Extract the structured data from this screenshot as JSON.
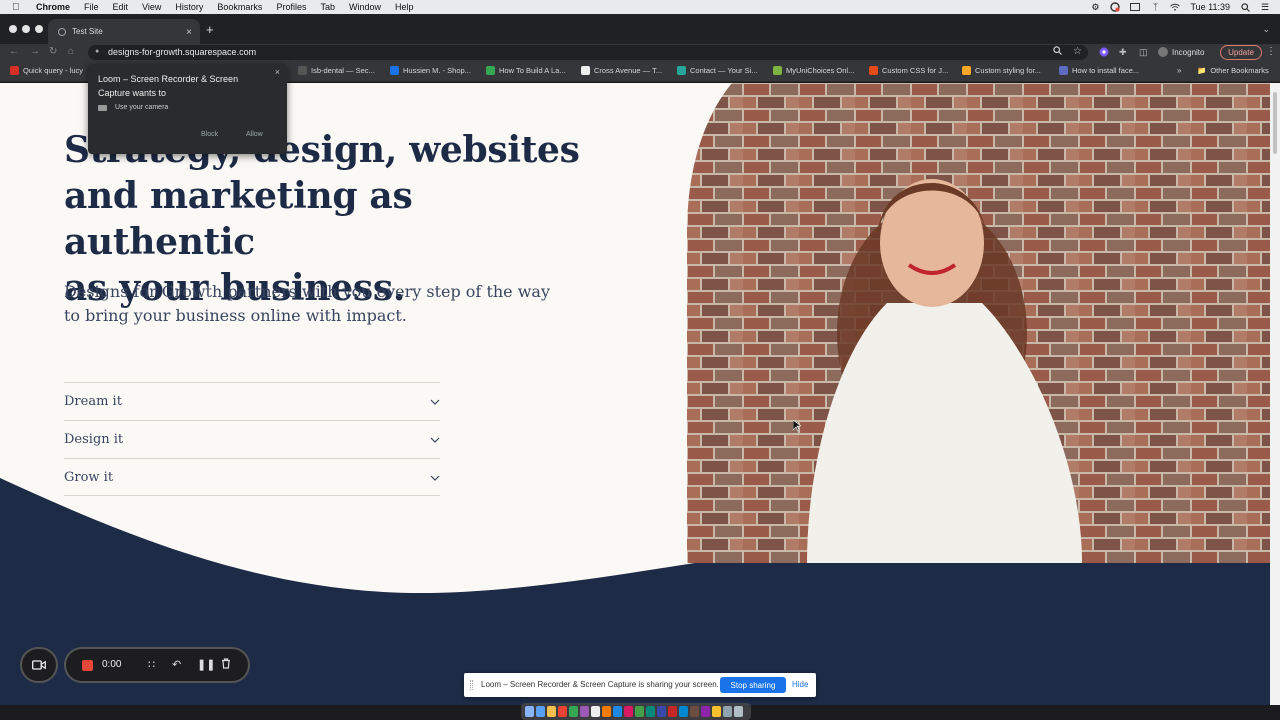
{
  "menubar": {
    "app": "Chrome",
    "items": [
      "File",
      "Edit",
      "View",
      "History",
      "Bookmarks",
      "Profiles",
      "Tab",
      "Window",
      "Help"
    ],
    "clock": "Tue 11:39"
  },
  "tab": {
    "title": "Test Site"
  },
  "toolbar": {
    "url": "designs-for-growth.squarespace.com",
    "incognito": "Incognito",
    "update": "Update"
  },
  "bookmarks": {
    "items": [
      {
        "label": "Quick query - lucy",
        "color": "#d93025"
      },
      {
        "label": "Isb-dental — Sec...",
        "color": "#555"
      },
      {
        "label": "Hussien M. - Shop...",
        "color": "#1a73e8"
      },
      {
        "label": "How To Build A La...",
        "color": "#34a853"
      },
      {
        "label": "Cross Avenue — T...",
        "color": "#eee"
      },
      {
        "label": "Contact — Your Si...",
        "color": "#26a69a"
      },
      {
        "label": "MyUniChoices Onl...",
        "color": "#7cb342"
      },
      {
        "label": "Custom CSS for J...",
        "color": "#e64a19"
      },
      {
        "label": "Custom styling for...",
        "color": "#f9a825"
      },
      {
        "label": "How to install face...",
        "color": "#5c6bc0"
      }
    ],
    "other": "Other Bookmarks"
  },
  "page": {
    "headline_lines": [
      "Strategy, design, websites",
      "and marketing as authentic",
      "as your business."
    ],
    "subhead": "Designs for Growth partners with you every step of the way to bring your business online with impact.",
    "accordion": [
      "Dream it",
      "Design it",
      "Grow it"
    ],
    "colors": {
      "navy": "#1e2b47",
      "cream": "#fbf9f5",
      "text": "#394560"
    }
  },
  "permission_popup": {
    "title": "Loom – Screen Recorder & Screen Capture wants to",
    "request": "Use your camera",
    "block": "Block",
    "allow": "Allow"
  },
  "recorder": {
    "time": "0:00"
  },
  "sharebar": {
    "message": "Loom – Screen Recorder & Screen Capture is sharing your screen.",
    "stop": "Stop sharing",
    "hide": "Hide"
  }
}
